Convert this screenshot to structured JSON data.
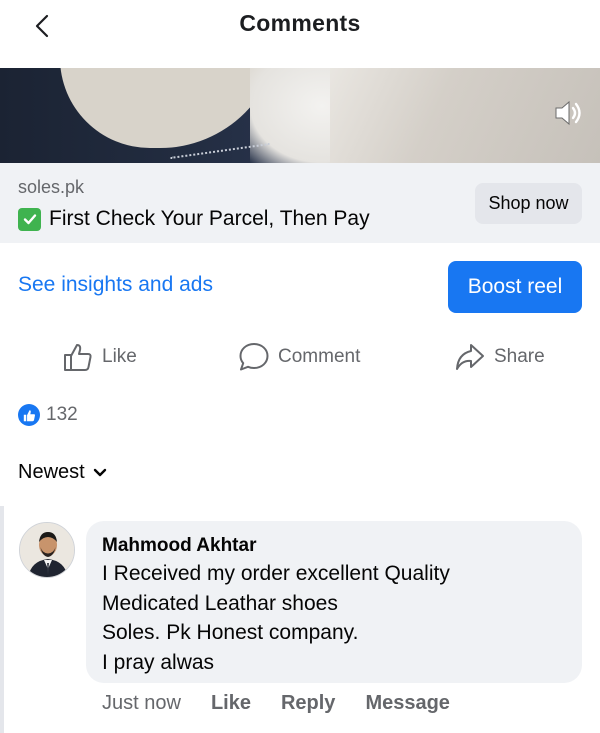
{
  "header": {
    "title": "Comments"
  },
  "ad": {
    "domain": "soles.pk",
    "headline": "First Check Your Parcel, Then Pay",
    "shop_button": "Shop now"
  },
  "insights": {
    "link": "See insights and ads",
    "boost_button": "Boost reel"
  },
  "actions": {
    "like": "Like",
    "comment": "Comment",
    "share": "Share"
  },
  "reactions": {
    "count": "132"
  },
  "sort": {
    "label": "Newest"
  },
  "comments": [
    {
      "author": "Mahmood Akhtar",
      "lines": [
        "I Received my order excellent Quality",
        "Medicated Leathar shoes",
        "Soles. Pk Honest company.",
        "I pray alwas"
      ],
      "time": "Just now",
      "like": "Like",
      "reply": "Reply",
      "message": "Message"
    }
  ],
  "colors": {
    "accent": "#1877f2",
    "muted": "#65676b",
    "surface": "#f0f2f5"
  }
}
